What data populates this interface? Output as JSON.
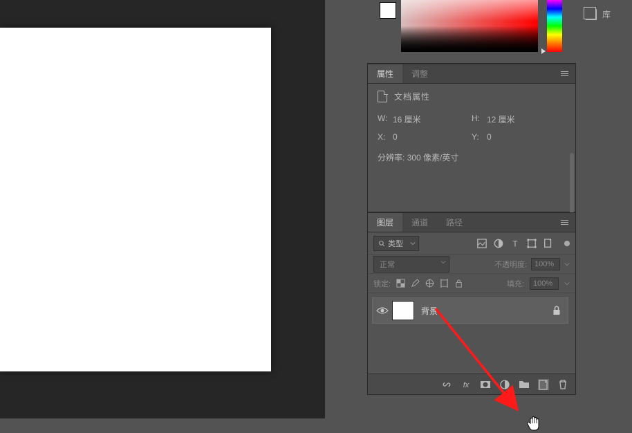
{
  "sidebar_right": {
    "library": "库"
  },
  "panels": {
    "properties": {
      "tabs": {
        "attributes": "属性",
        "adjustments": "调整"
      },
      "title": "文档属性",
      "w_label": "W:",
      "w_value": "16 厘米",
      "h_label": "H:",
      "h_value": "12 厘米",
      "x_label": "X:",
      "x_value": "0",
      "y_label": "Y:",
      "y_value": "0",
      "res_label": "分辨率:",
      "res_value": "300 像素/英寸"
    },
    "layers": {
      "tabs": {
        "layers": "图层",
        "channels": "通道",
        "paths": "路径"
      },
      "filter_kind": "类型",
      "blend_mode": "正常",
      "opacity_label": "不透明度:",
      "opacity_value": "100%",
      "lock_label": "锁定:",
      "fill_label": "填充:",
      "fill_value": "100%",
      "layer_items": [
        {
          "name": "背景",
          "locked": true
        }
      ]
    }
  }
}
